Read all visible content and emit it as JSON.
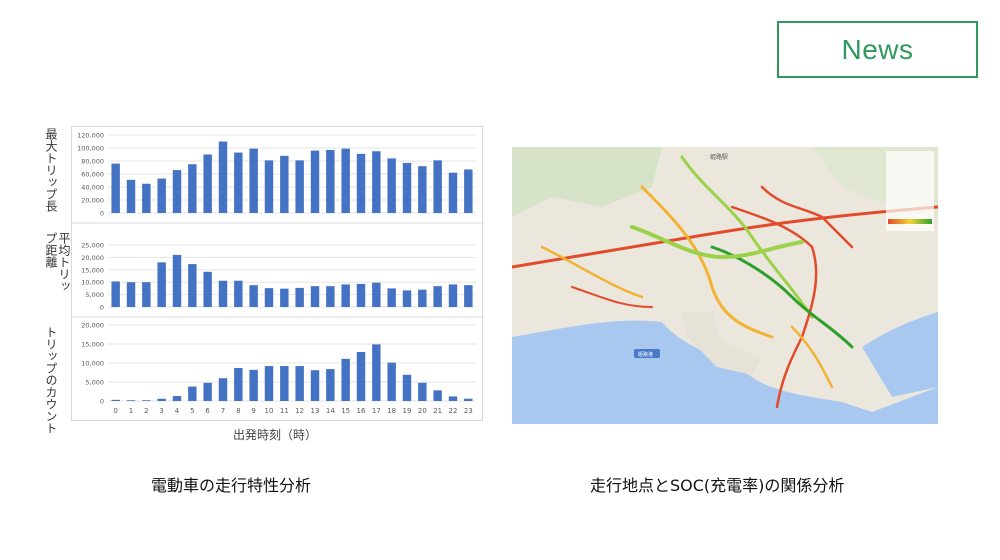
{
  "news_label": "News",
  "chart_data": [
    {
      "type": "bar",
      "ylabel": "最大トリップ長",
      "categories": [
        "0",
        "1",
        "2",
        "3",
        "4",
        "5",
        "6",
        "7",
        "8",
        "9",
        "10",
        "11",
        "12",
        "13",
        "14",
        "15",
        "16",
        "17",
        "18",
        "19",
        "20",
        "21",
        "22",
        "23"
      ],
      "values": [
        76000,
        51000,
        45000,
        53000,
        66000,
        75000,
        90000,
        110000,
        93000,
        99000,
        81000,
        88000,
        81000,
        96000,
        97000,
        99000,
        91000,
        95000,
        84000,
        77000,
        72000,
        81000,
        62000,
        67000
      ],
      "ylim": [
        0,
        120000
      ],
      "yticks": [
        "0",
        "20,000",
        "40,000",
        "60,000",
        "80,000",
        "100,000",
        "120,000"
      ],
      "color": "#4472c4"
    },
    {
      "type": "bar",
      "ylabel": "平均トリップ距離",
      "categories": [
        "0",
        "1",
        "2",
        "3",
        "4",
        "5",
        "6",
        "7",
        "8",
        "9",
        "10",
        "11",
        "12",
        "13",
        "14",
        "15",
        "16",
        "17",
        "18",
        "19",
        "20",
        "21",
        "22",
        "23"
      ],
      "values": [
        10300,
        10000,
        10000,
        18000,
        21000,
        17300,
        14200,
        10600,
        10600,
        8800,
        7600,
        7400,
        7700,
        8400,
        8400,
        9100,
        9300,
        9800,
        7500,
        6700,
        7000,
        8400,
        9100,
        8800
      ],
      "ylim": [
        0,
        25000
      ],
      "yticks": [
        "0",
        "5,000",
        "10,000",
        "15,000",
        "20,000",
        "25,000"
      ],
      "color": "#4472c4"
    },
    {
      "type": "bar",
      "ylabel": "トリップのカウント",
      "categories": [
        "0",
        "1",
        "2",
        "3",
        "4",
        "5",
        "6",
        "7",
        "8",
        "9",
        "10",
        "11",
        "12",
        "13",
        "14",
        "15",
        "16",
        "17",
        "18",
        "19",
        "20",
        "21",
        "22",
        "23"
      ],
      "values": [
        300,
        200,
        200,
        600,
        1300,
        3800,
        4800,
        6000,
        8700,
        8200,
        9200,
        9200,
        9200,
        8100,
        8400,
        11100,
        12900,
        14900,
        10100,
        6900,
        4800,
        2800,
        1200,
        600
      ],
      "ylim": [
        0,
        20000
      ],
      "yticks": [
        "0",
        "5,000",
        "10,000",
        "15,000",
        "20,000"
      ],
      "color": "#4472c4"
    }
  ],
  "x_axis_title": "出発時刻（時）",
  "captions": {
    "left": "電動車の走行特性分析",
    "right": "走行地点とSOC(充電率)の関係分析"
  },
  "map": {
    "label_station": "姫路駅",
    "port_label": "姫路港",
    "colors": {
      "sea": "#a9c8f0",
      "land": "#ece7dd",
      "high": "#2ca02c",
      "mid": "#f2b233",
      "low": "#e24a2b"
    }
  }
}
